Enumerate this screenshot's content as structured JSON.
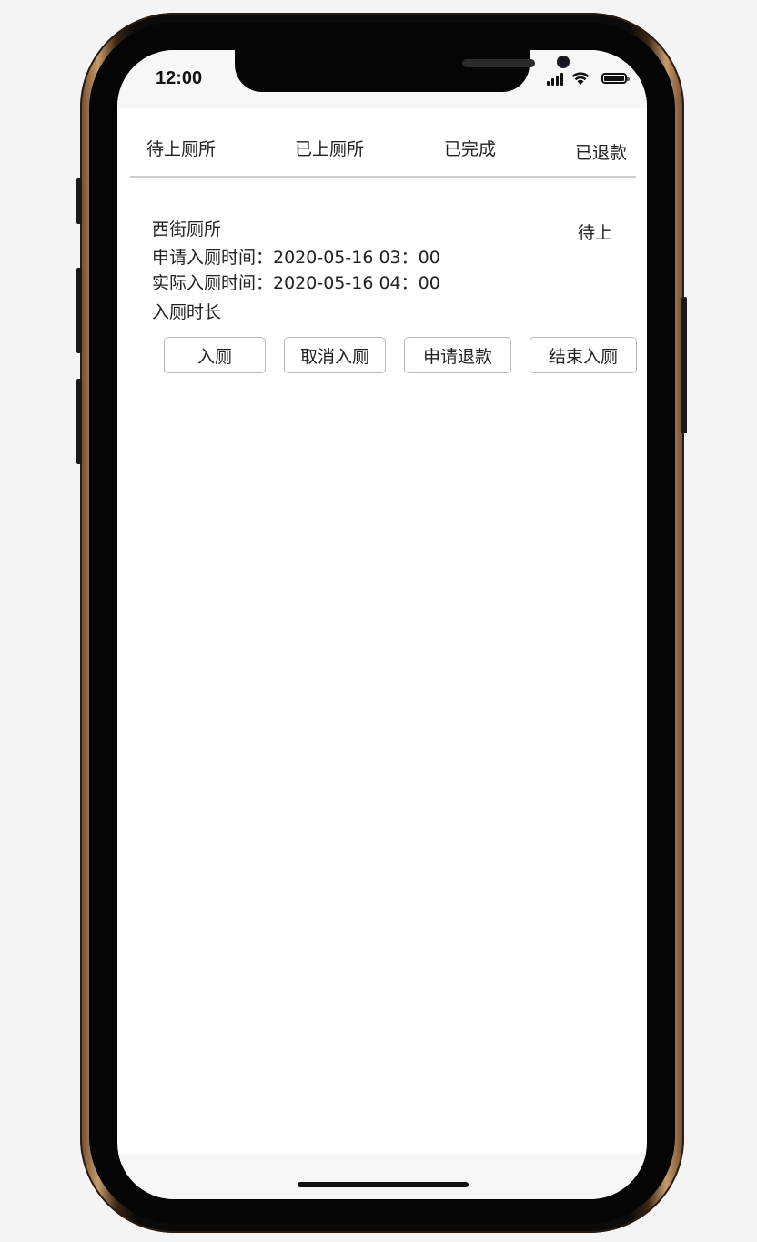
{
  "status_bar": {
    "time": "12:00",
    "icons": [
      "signal-icon",
      "wifi-icon",
      "battery-icon"
    ]
  },
  "tabs": [
    {
      "label": "待上厕所"
    },
    {
      "label": "已上厕所"
    },
    {
      "label": "已完成"
    },
    {
      "label": "已退款"
    }
  ],
  "order": {
    "name": "西街厕所",
    "status": "待上",
    "apply_time": "申请入厕时间：2020-05-16 03：00",
    "actual_time": "实际入厕时间：2020-05-16 04：00",
    "duration": "入厕时长"
  },
  "actions": [
    {
      "label": "入厕"
    },
    {
      "label": "取消入厕"
    },
    {
      "label": "申请退款"
    },
    {
      "label": "结束入厕"
    }
  ],
  "colors": {
    "frame_gold": "#c79c6e",
    "text": "#222222",
    "divider": "#cfcfcf",
    "button_border": "#b8b8b8"
  }
}
